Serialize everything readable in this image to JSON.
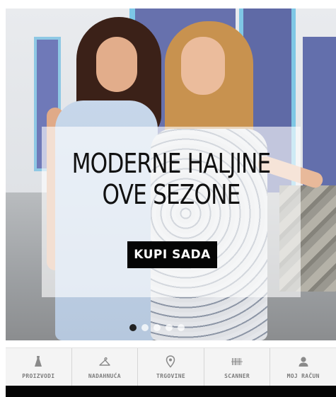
{
  "banner": {
    "title_line1": "MODERNE HALJINE",
    "title_line2": "OVE SEZONE",
    "cta_label": "KUPI SADA"
  },
  "carousel": {
    "slide_count": 5,
    "active_index": 0
  },
  "nav": {
    "items": [
      {
        "label": "PROIZVODI",
        "icon": "dress-icon"
      },
      {
        "label": "NADAHNUĆA",
        "icon": "hanger-icon"
      },
      {
        "label": "TRGOVINE",
        "icon": "location-pin-icon"
      },
      {
        "label": "SCANNER",
        "icon": "barcode-icon"
      },
      {
        "label": "MOJ RAČUN",
        "icon": "user-icon"
      }
    ]
  },
  "colors": {
    "cta_bg": "#050505",
    "nav_bg": "#f4f4f4",
    "nav_text": "#7d7d7d"
  }
}
